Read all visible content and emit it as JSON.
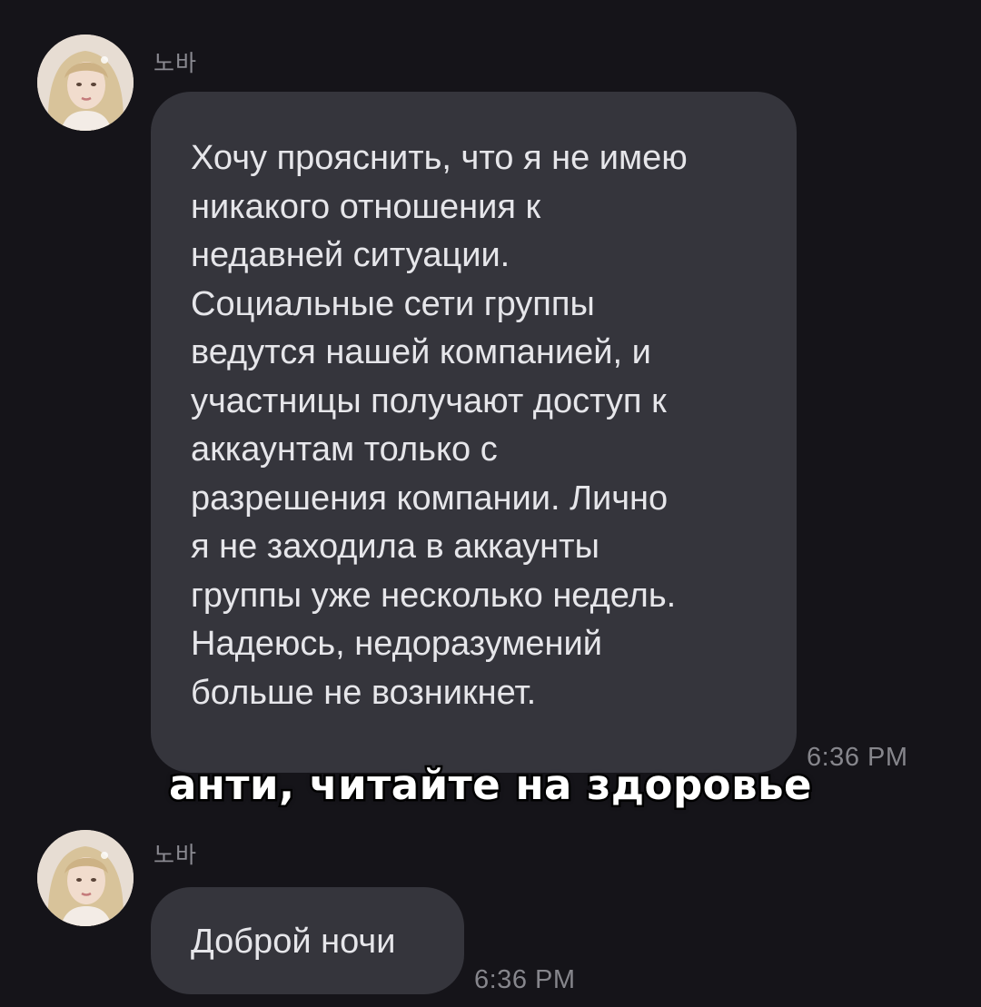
{
  "messages": [
    {
      "sender": "노바",
      "text": "Хочу прояснить, что я не имею\nникакого отношения к\nнедавней ситуации.\nСоциальные сети группы\nведутся нашей компанией, и\nучастницы получают доступ к\nаккаунтам только с\nразрешения компании. Лично\nя не заходила в аккаунты\nгруппы уже несколько недель.\nНадеюсь, недоразумений\nбольше не возникнет.",
      "time": "6:36 PM"
    },
    {
      "sender": "노바",
      "text": "Доброй ночи",
      "time": "6:36 PM"
    }
  ],
  "caption": "анти, читайте на здоровье",
  "colors": {
    "background": "#151419",
    "bubble": "#35353c",
    "text": "#e6e6ea",
    "meta": "#86868c"
  },
  "icons": {
    "avatar": "profile-photo"
  }
}
